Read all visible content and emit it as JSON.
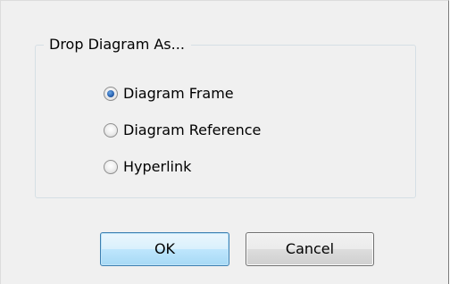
{
  "group": {
    "caption": "Drop Diagram As..."
  },
  "options": [
    {
      "label": "Diagram Frame",
      "selected": true
    },
    {
      "label": "Diagram Reference",
      "selected": false
    },
    {
      "label": "Hyperlink",
      "selected": false
    }
  ],
  "buttons": {
    "ok_label": "OK",
    "cancel_label": "Cancel"
  },
  "colors": {
    "dialog_background": "#f0f0f0",
    "default_button_border": "#3c7fb1",
    "radio_selected": "#2b64b3"
  }
}
